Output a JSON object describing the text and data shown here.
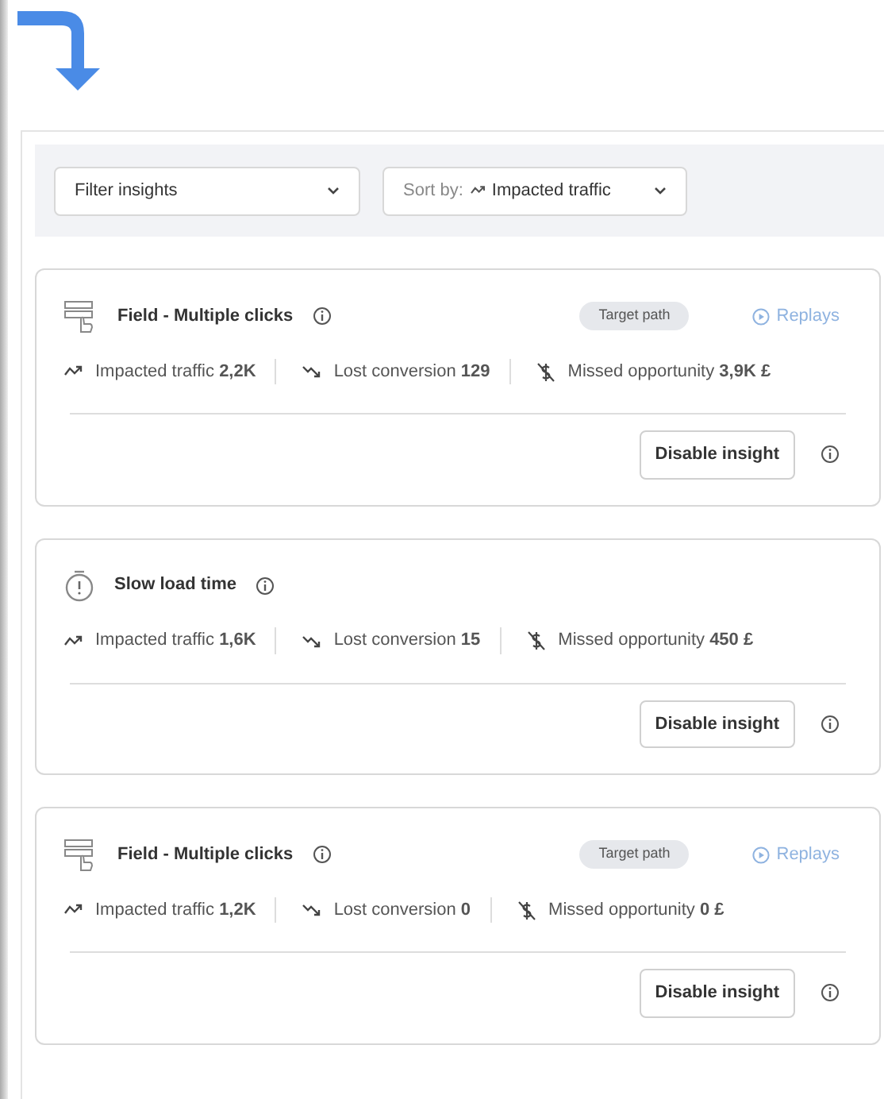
{
  "filters": {
    "filter": {
      "placeholder": "Filter insights"
    },
    "sort": {
      "label": "Sort by:",
      "value": "Impacted traffic"
    }
  },
  "insights": [
    {
      "kind": "field",
      "title": "Field - Multiple clicks",
      "tag": "Target path",
      "replays": "Replays",
      "metrics": [
        {
          "kind": "traffic",
          "text": "Impacted traffic **2,2K**"
        },
        {
          "kind": "conversion",
          "text": "Lost conversion **129**"
        },
        {
          "kind": "opportunity",
          "text": "Missed opportunity **3,9K £**"
        }
      ],
      "action": "Disable insight"
    },
    {
      "kind": "timer",
      "title": "Slow load time",
      "metrics": [
        {
          "kind": "traffic",
          "text": "Impacted traffic **1,6K**"
        },
        {
          "kind": "conversion",
          "text": "Lost conversion **15**"
        },
        {
          "kind": "opportunity",
          "text": "Missed opportunity **450 £**"
        }
      ],
      "action": "Disable insight"
    },
    {
      "kind": "field",
      "title": "Field - Multiple clicks",
      "tag": "Target path",
      "replays": "Replays",
      "metrics": [
        {
          "kind": "traffic",
          "text": "Impacted traffic **1,2K**"
        },
        {
          "kind": "conversion",
          "text": "Lost conversion **0**"
        },
        {
          "kind": "opportunity",
          "text": "Missed opportunity **0 £**"
        }
      ],
      "action": "Disable insight"
    }
  ]
}
